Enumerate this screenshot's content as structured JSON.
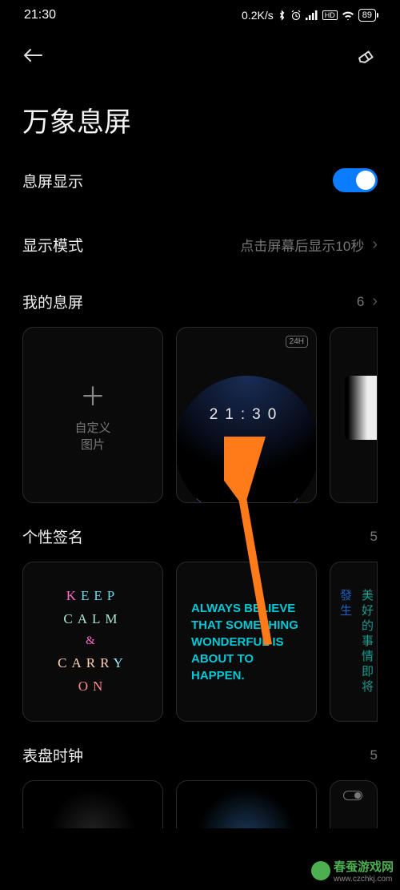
{
  "status": {
    "time": "21:30",
    "speed": "0.2K/s",
    "battery": "89"
  },
  "page": {
    "title": "万象息屏"
  },
  "settings": {
    "aod_display": {
      "label": "息屏显示",
      "on": true
    },
    "display_mode": {
      "label": "显示模式",
      "value": "点击屏幕后显示10秒"
    }
  },
  "sections": {
    "my_aod": {
      "title": "我的息屏",
      "count": "6"
    },
    "signature": {
      "title": "个性签名",
      "count": "5"
    },
    "dial_clock": {
      "title": "表盘时钟",
      "count": "5"
    }
  },
  "cards": {
    "custom_image": {
      "line1": "自定义",
      "line2": "图片"
    },
    "clock": {
      "badge": "24H",
      "time": "21:30"
    },
    "keep_calm": {
      "l1": "KEEP",
      "l2": "CALM",
      "l3": "&",
      "l4": "CARRY",
      "l5": "ON"
    },
    "believe": "ALWAYS BELIEVE THAT SOMETHING WONDERFUL IS ABOUT TO HAPPEN.",
    "chinese": {
      "c1": "發生",
      "c2": "美好的事情即将"
    }
  },
  "watermark": {
    "cn": "春蚕游戏网",
    "url": "www.czchkj.com"
  }
}
